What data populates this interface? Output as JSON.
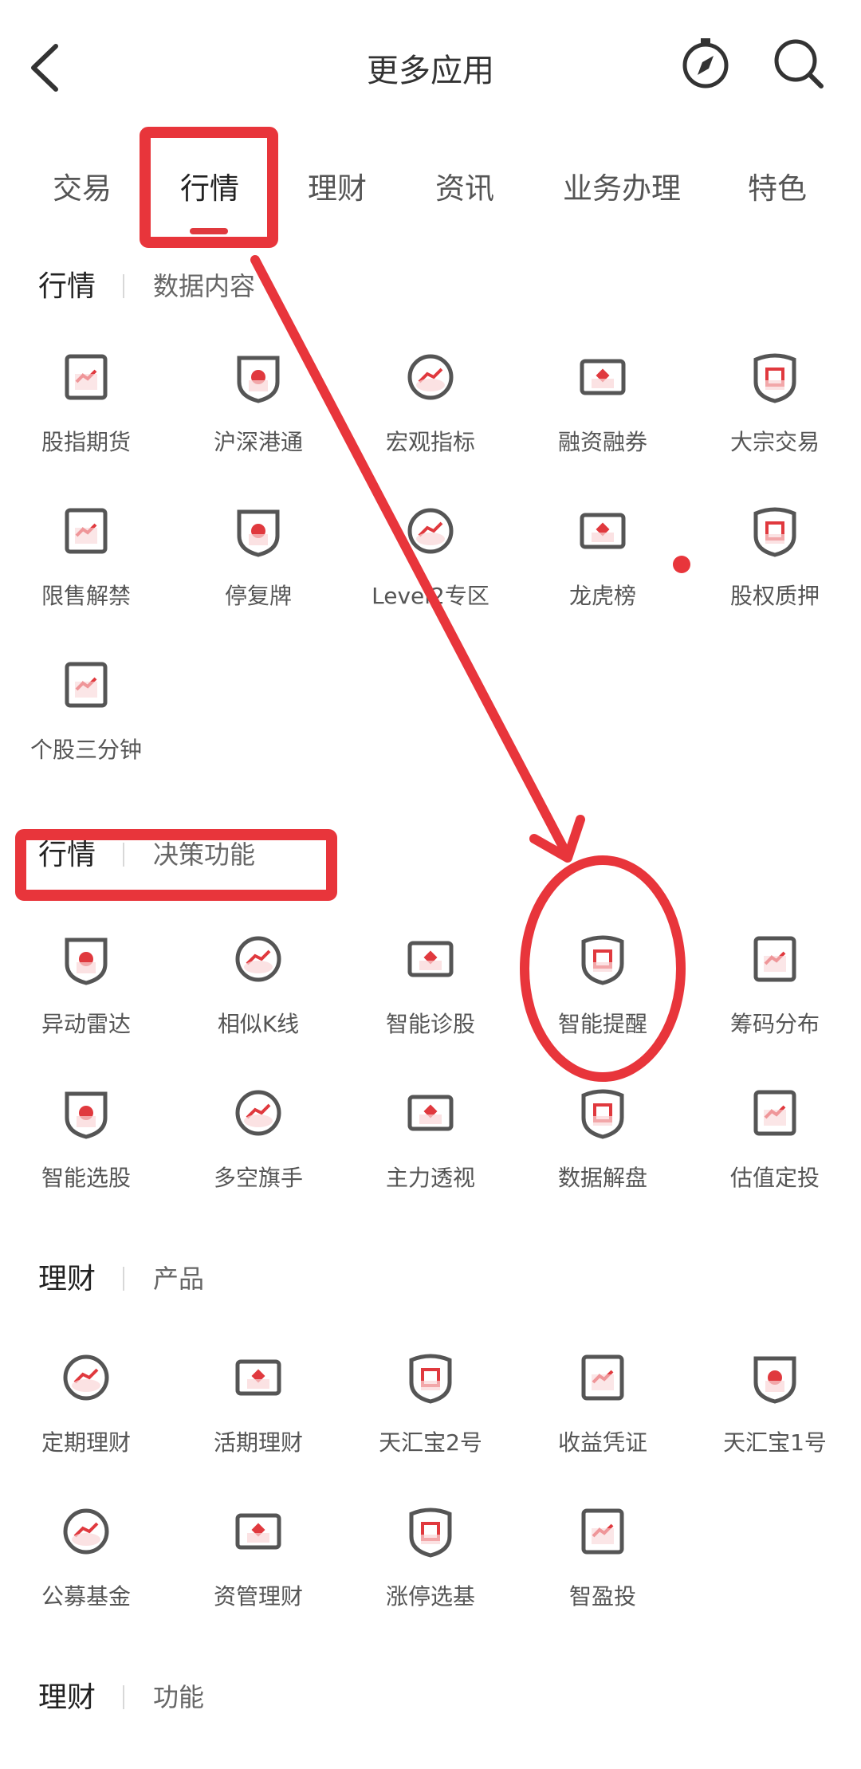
{
  "header": {
    "title": "更多应用",
    "back_icon": "chevron-left-icon",
    "icons": [
      "compass-icon",
      "search-icon"
    ]
  },
  "tabs": [
    {
      "label": "交易"
    },
    {
      "label": "行情"
    },
    {
      "label": "理财"
    },
    {
      "label": "资讯"
    },
    {
      "label": "业务办理"
    },
    {
      "label": "特色"
    }
  ],
  "active_tab": "行情",
  "sections": [
    {
      "main": "行情",
      "sub": "数据内容",
      "items": [
        "股指期货",
        "沪深港通",
        "宏观指标",
        "融资融券",
        "大宗交易",
        "限售解禁",
        "停复牌",
        "Level2专区",
        "龙虎榜",
        "股权质押",
        "个股三分钟"
      ]
    },
    {
      "main": "行情",
      "sub": "决策功能",
      "items": [
        "异动雷达",
        "相似K线",
        "智能诊股",
        "智能提醒",
        "筹码分布",
        "智能选股",
        "多空旗手",
        "主力透视",
        "数据解盘",
        "估值定投"
      ]
    },
    {
      "main": "理财",
      "sub": "产品",
      "items": [
        "定期理财",
        "活期理财",
        "天汇宝2号",
        "收益凭证",
        "天汇宝1号",
        "公募基金",
        "资管理财",
        "涨停选基",
        "智盈投"
      ]
    },
    {
      "main": "理财",
      "sub": "功能",
      "items": []
    }
  ],
  "colors": {
    "accent": "#e0393e",
    "annotation": "#e8353b",
    "icon_stroke": "#555555",
    "icon_fill": "#f9d6d7"
  }
}
